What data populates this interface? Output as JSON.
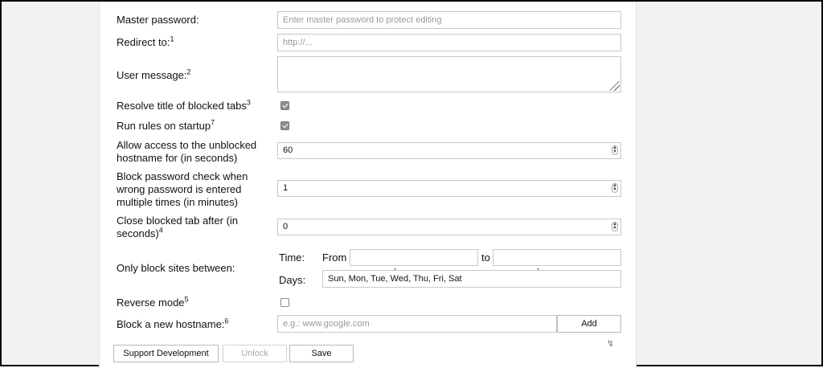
{
  "fields": {
    "master_password": {
      "label": "Master password:",
      "placeholder": "Enter master password to protect editing",
      "value": ""
    },
    "redirect_to": {
      "label": "Redirect to:",
      "sup": "1",
      "placeholder": "http://...",
      "value": ""
    },
    "user_message": {
      "label": "User message:",
      "sup": "2",
      "value": ""
    },
    "resolve_title": {
      "label": "Resolve title of blocked tabs",
      "sup": "3",
      "checked": true
    },
    "run_rules": {
      "label": "Run rules on startup",
      "sup": "7",
      "checked": true
    },
    "allow_access": {
      "label_line1": "Allow access to the unblocked",
      "label_line2": "hostname for (in seconds)",
      "value": "60"
    },
    "block_password": {
      "label_line1": "Block password check when",
      "label_line2": "wrong password is entered",
      "label_line3": "multiple times (in minutes)",
      "value": "1"
    },
    "close_tab": {
      "label_line1": "Close blocked tab after (in",
      "label_line2": "seconds)",
      "sup": "4",
      "value": "0"
    },
    "only_block": {
      "label": "Only block sites between:",
      "time_label": "Time:",
      "from_label": "From",
      "from_value": "-- : --   --",
      "to_label": "to",
      "to_value": "-- : --   --",
      "days_label": "Days:",
      "days_value": "Sun, Mon, Tue, Wed, Thu, Fri, Sat"
    },
    "reverse_mode": {
      "label": "Reverse mode",
      "sup": "5",
      "checked": false
    },
    "block_hostname": {
      "label": "Block a new hostname:",
      "sup": "6",
      "placeholder": "e.g.: www.google.com",
      "add_label": "Add"
    }
  },
  "footer": {
    "support_label": "Support Development",
    "unlock_label": "Unlock",
    "save_label": "Save"
  },
  "colors": {
    "panel": "#ffffff",
    "background": "#f2f2f2",
    "border": "#c8c8c8"
  }
}
